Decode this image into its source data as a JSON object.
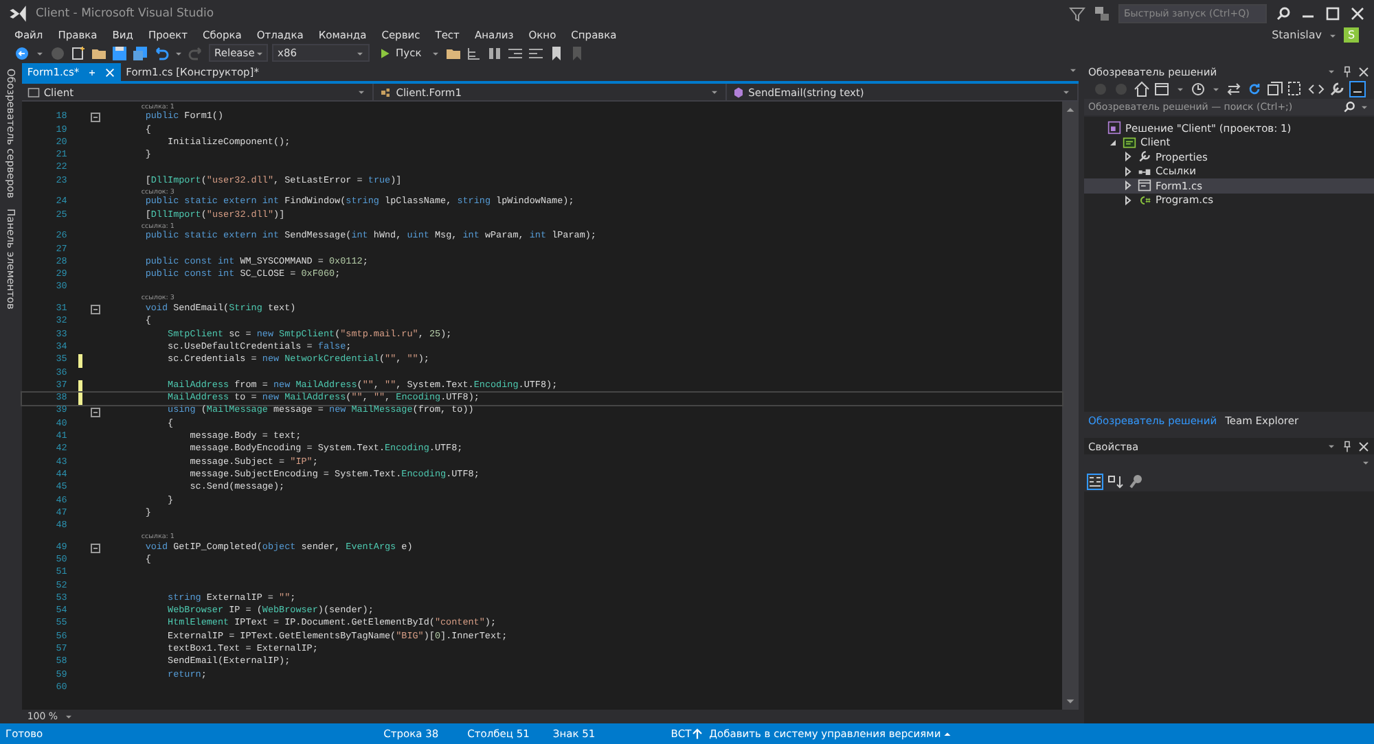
{
  "window": {
    "title": "Client - Microsoft Visual Studio",
    "quick_launch": {
      "placeholder": "Быстрый запуск (Ctrl+Q)"
    },
    "user": {
      "name": "Stanislav",
      "avatar": "S"
    }
  },
  "menu": [
    "Файл",
    "Правка",
    "Вид",
    "Проект",
    "Сборка",
    "Отладка",
    "Команда",
    "Сервис",
    "Тест",
    "Анализ",
    "Окно",
    "Справка"
  ],
  "toolbar": {
    "configuration": "Release",
    "platform": "x86",
    "run": "Пуск"
  },
  "side_tabs": [
    "Обозреватель серверов",
    "Панель элементов"
  ],
  "document_tabs": [
    {
      "label": "Form1.cs*",
      "selected": true
    },
    {
      "label": "Form1.cs [Конструктор]*",
      "selected": false
    }
  ],
  "navigation": {
    "project": "Client",
    "type": "Client.Form1",
    "member": "SendEmail(string text)"
  },
  "code": {
    "lines": [
      {
        "number": "18",
        "lens": "ссылка: 1",
        "foldable": true,
        "modified": false,
        "current": false,
        "tokens": [
          {
            "kind": "kw",
            "text": "public "
          },
          {
            "kind": "p",
            "text": "Form1()"
          }
        ]
      },
      {
        "number": "19",
        "foldable": false,
        "modified": false,
        "current": false,
        "tokens": [
          {
            "kind": "p",
            "text": "{"
          }
        ]
      },
      {
        "number": "20",
        "foldable": false,
        "modified": false,
        "current": false,
        "tokens": [
          {
            "kind": "p",
            "text": "    InitializeComponent();"
          }
        ]
      },
      {
        "number": "21",
        "foldable": false,
        "modified": false,
        "current": false,
        "tokens": [
          {
            "kind": "p",
            "text": "}"
          }
        ]
      },
      {
        "number": "22",
        "foldable": false,
        "modified": false,
        "current": false
      },
      {
        "number": "23",
        "foldable": false,
        "modified": false,
        "current": false,
        "tokens": [
          {
            "kind": "p",
            "text": "["
          },
          {
            "kind": "type",
            "text": "DllImport"
          },
          {
            "kind": "p",
            "text": "("
          },
          {
            "kind": "str",
            "text": "\"user32.dll\""
          },
          {
            "kind": "p",
            "text": ", SetLastError = "
          },
          {
            "kind": "kw",
            "text": "true"
          },
          {
            "kind": "p",
            "text": ")]"
          }
        ]
      },
      {
        "number": "24",
        "lens": "ссылок: 3",
        "foldable": false,
        "modified": false,
        "current": false,
        "tokens": [
          {
            "kind": "kw",
            "text": "public static extern int "
          },
          {
            "kind": "p",
            "text": "FindWindow("
          },
          {
            "kind": "kw",
            "text": "string "
          },
          {
            "kind": "p",
            "text": "lpClassName, "
          },
          {
            "kind": "kw",
            "text": "string "
          },
          {
            "kind": "p",
            "text": "lpWindowName);"
          }
        ]
      },
      {
        "number": "25",
        "foldable": false,
        "modified": false,
        "current": false,
        "tokens": [
          {
            "kind": "p",
            "text": "["
          },
          {
            "kind": "type",
            "text": "DllImport"
          },
          {
            "kind": "p",
            "text": "("
          },
          {
            "kind": "str",
            "text": "\"user32.dll\""
          },
          {
            "kind": "p",
            "text": ")]"
          }
        ]
      },
      {
        "number": "26",
        "lens": "ссылка: 1",
        "foldable": false,
        "modified": false,
        "current": false,
        "tokens": [
          {
            "kind": "kw",
            "text": "public static extern int "
          },
          {
            "kind": "p",
            "text": "SendMessage("
          },
          {
            "kind": "kw",
            "text": "int "
          },
          {
            "kind": "p",
            "text": "hWnd, "
          },
          {
            "kind": "kw",
            "text": "uint "
          },
          {
            "kind": "p",
            "text": "Msg, "
          },
          {
            "kind": "kw",
            "text": "int "
          },
          {
            "kind": "p",
            "text": "wParam, "
          },
          {
            "kind": "kw",
            "text": "int "
          },
          {
            "kind": "p",
            "text": "lParam);"
          }
        ]
      },
      {
        "number": "27",
        "foldable": false,
        "modified": false,
        "current": false
      },
      {
        "number": "28",
        "foldable": false,
        "modified": false,
        "current": false,
        "tokens": [
          {
            "kind": "kw",
            "text": "public const int "
          },
          {
            "kind": "p",
            "text": "WM_SYSCOMMAND = "
          },
          {
            "kind": "num",
            "text": "0x0112"
          },
          {
            "kind": "p",
            "text": ";"
          }
        ]
      },
      {
        "number": "29",
        "foldable": false,
        "modified": false,
        "current": false,
        "tokens": [
          {
            "kind": "kw",
            "text": "public const int "
          },
          {
            "kind": "p",
            "text": "SC_CLOSE = "
          },
          {
            "kind": "num",
            "text": "0xF060"
          },
          {
            "kind": "p",
            "text": ";"
          }
        ]
      },
      {
        "number": "30",
        "foldable": false,
        "modified": false,
        "current": false
      },
      {
        "number": "31",
        "lens": "ссылок: 3",
        "foldable": true,
        "modified": false,
        "current": false,
        "tokens": [
          {
            "kind": "kw",
            "text": "void "
          },
          {
            "kind": "p",
            "text": "SendEmail("
          },
          {
            "kind": "type",
            "text": "String "
          },
          {
            "kind": "p",
            "text": "text)"
          }
        ]
      },
      {
        "number": "32",
        "foldable": false,
        "modified": false,
        "current": false,
        "tokens": [
          {
            "kind": "p",
            "text": "{"
          }
        ]
      },
      {
        "number": "33",
        "foldable": false,
        "modified": false,
        "current": false,
        "tokens": [
          {
            "kind": "type",
            "text": "    SmtpClient "
          },
          {
            "kind": "p",
            "text": "sc = "
          },
          {
            "kind": "kw",
            "text": "new "
          },
          {
            "kind": "type",
            "text": "SmtpClient"
          },
          {
            "kind": "p",
            "text": "("
          },
          {
            "kind": "str",
            "text": "\"smtp.mail.ru\""
          },
          {
            "kind": "p",
            "text": ", "
          },
          {
            "kind": "num",
            "text": "25"
          },
          {
            "kind": "p",
            "text": ");"
          }
        ]
      },
      {
        "number": "34",
        "foldable": false,
        "modified": false,
        "current": false,
        "tokens": [
          {
            "kind": "p",
            "text": "    sc.UseDefaultCredentials = "
          },
          {
            "kind": "kw",
            "text": "false"
          },
          {
            "kind": "p",
            "text": ";"
          }
        ]
      },
      {
        "number": "35",
        "foldable": false,
        "modified": true,
        "current": false,
        "tokens": [
          {
            "kind": "p",
            "text": "    sc.Credentials = "
          },
          {
            "kind": "kw",
            "text": "new "
          },
          {
            "kind": "type",
            "text": "NetworkCredential"
          },
          {
            "kind": "p",
            "text": "("
          },
          {
            "kind": "str",
            "text": "\"\""
          },
          {
            "kind": "p",
            "text": ", "
          },
          {
            "kind": "str",
            "text": "\"\""
          },
          {
            "kind": "p",
            "text": ");"
          }
        ]
      },
      {
        "number": "36",
        "foldable": false,
        "modified": false,
        "current": false
      },
      {
        "number": "37",
        "foldable": false,
        "modified": true,
        "current": false,
        "tokens": [
          {
            "kind": "type",
            "text": "    MailAddress "
          },
          {
            "kind": "p",
            "text": "from = "
          },
          {
            "kind": "kw",
            "text": "new "
          },
          {
            "kind": "type",
            "text": "MailAddress"
          },
          {
            "kind": "p",
            "text": "("
          },
          {
            "kind": "str",
            "text": "\"\""
          },
          {
            "kind": "p",
            "text": ", "
          },
          {
            "kind": "str",
            "text": "\"\""
          },
          {
            "kind": "p",
            "text": ", System.Text."
          },
          {
            "kind": "type",
            "text": "Encoding"
          },
          {
            "kind": "p",
            "text": ".UTF8);"
          }
        ]
      },
      {
        "number": "38",
        "foldable": false,
        "modified": true,
        "current": true,
        "tokens": [
          {
            "kind": "type",
            "text": "    MailAddress "
          },
          {
            "kind": "p",
            "text": "to = "
          },
          {
            "kind": "kw",
            "text": "new "
          },
          {
            "kind": "type",
            "text": "MailAddress"
          },
          {
            "kind": "p",
            "text": "("
          },
          {
            "kind": "str",
            "text": "\"\""
          },
          {
            "kind": "p",
            "text": ", "
          },
          {
            "kind": "str",
            "text": "\"\""
          },
          {
            "kind": "p",
            "text": ", "
          },
          {
            "kind": "type",
            "text": "Encoding"
          },
          {
            "kind": "p",
            "text": ".UTF8);"
          }
        ]
      },
      {
        "number": "39",
        "foldable": true,
        "modified": false,
        "current": false,
        "tokens": [
          {
            "kind": "kw",
            "text": "    using "
          },
          {
            "kind": "p",
            "text": "("
          },
          {
            "kind": "type",
            "text": "MailMessage "
          },
          {
            "kind": "p",
            "text": "message = "
          },
          {
            "kind": "kw",
            "text": "new "
          },
          {
            "kind": "type",
            "text": "MailMessage"
          },
          {
            "kind": "p",
            "text": "(from, to))"
          }
        ]
      },
      {
        "number": "40",
        "foldable": false,
        "modified": false,
        "current": false,
        "tokens": [
          {
            "kind": "p",
            "text": "    {"
          }
        ]
      },
      {
        "number": "41",
        "foldable": false,
        "modified": false,
        "current": false,
        "tokens": [
          {
            "kind": "p",
            "text": "        message.Body = text;"
          }
        ]
      },
      {
        "number": "42",
        "foldable": false,
        "modified": false,
        "current": false,
        "tokens": [
          {
            "kind": "p",
            "text": "        message.BodyEncoding = System.Text."
          },
          {
            "kind": "type",
            "text": "Encoding"
          },
          {
            "kind": "p",
            "text": ".UTF8;"
          }
        ]
      },
      {
        "number": "43",
        "foldable": false,
        "modified": false,
        "current": false,
        "tokens": [
          {
            "kind": "p",
            "text": "        message.Subject = "
          },
          {
            "kind": "str",
            "text": "\"IP\""
          },
          {
            "kind": "p",
            "text": ";"
          }
        ]
      },
      {
        "number": "44",
        "foldable": false,
        "modified": false,
        "current": false,
        "tokens": [
          {
            "kind": "p",
            "text": "        message.SubjectEncoding = System.Text."
          },
          {
            "kind": "type",
            "text": "Encoding"
          },
          {
            "kind": "p",
            "text": ".UTF8;"
          }
        ]
      },
      {
        "number": "45",
        "foldable": false,
        "modified": false,
        "current": false,
        "tokens": [
          {
            "kind": "p",
            "text": "        sc.Send(message);"
          }
        ]
      },
      {
        "number": "46",
        "foldable": false,
        "modified": false,
        "current": false,
        "tokens": [
          {
            "kind": "p",
            "text": "    }"
          }
        ]
      },
      {
        "number": "47",
        "foldable": false,
        "modified": false,
        "current": false,
        "tokens": [
          {
            "kind": "p",
            "text": "}"
          }
        ]
      },
      {
        "number": "48",
        "foldable": false,
        "modified": false,
        "current": false
      },
      {
        "number": "49",
        "lens": "ссылка: 1",
        "foldable": true,
        "modified": false,
        "current": false,
        "tokens": [
          {
            "kind": "kw",
            "text": "void "
          },
          {
            "kind": "p",
            "text": "GetIP_Completed("
          },
          {
            "kind": "kw",
            "text": "object "
          },
          {
            "kind": "p",
            "text": "sender, "
          },
          {
            "kind": "type",
            "text": "EventArgs "
          },
          {
            "kind": "p",
            "text": "e)"
          }
        ]
      },
      {
        "number": "50",
        "foldable": false,
        "modified": false,
        "current": false,
        "tokens": [
          {
            "kind": "p",
            "text": "{"
          }
        ]
      },
      {
        "number": "51",
        "foldable": false,
        "modified": false,
        "current": false
      },
      {
        "number": "52",
        "foldable": false,
        "modified": false,
        "current": false
      },
      {
        "number": "53",
        "foldable": false,
        "modified": false,
        "current": false,
        "tokens": [
          {
            "kind": "kw",
            "text": "    string "
          },
          {
            "kind": "p",
            "text": "ExternalIP = "
          },
          {
            "kind": "str",
            "text": "\"\""
          },
          {
            "kind": "p",
            "text": ";"
          }
        ]
      },
      {
        "number": "54",
        "foldable": false,
        "modified": false,
        "current": false,
        "tokens": [
          {
            "kind": "type",
            "text": "    WebBrowser "
          },
          {
            "kind": "p",
            "text": "IP = ("
          },
          {
            "kind": "type",
            "text": "WebBrowser"
          },
          {
            "kind": "p",
            "text": ")(sender);"
          }
        ]
      },
      {
        "number": "55",
        "foldable": false,
        "modified": false,
        "current": false,
        "tokens": [
          {
            "kind": "type",
            "text": "    HtmlElement "
          },
          {
            "kind": "p",
            "text": "IPText = IP.Document.GetElementById("
          },
          {
            "kind": "str",
            "text": "\"content\""
          },
          {
            "kind": "p",
            "text": ");"
          }
        ]
      },
      {
        "number": "56",
        "foldable": false,
        "modified": false,
        "current": false,
        "tokens": [
          {
            "kind": "p",
            "text": "    ExternalIP = IPText.GetElementsByTagName("
          },
          {
            "kind": "str",
            "text": "\"BIG\""
          },
          {
            "kind": "p",
            "text": ")["
          },
          {
            "kind": "num",
            "text": "0"
          },
          {
            "kind": "p",
            "text": "].InnerText;"
          }
        ]
      },
      {
        "number": "57",
        "foldable": false,
        "modified": false,
        "current": false,
        "tokens": [
          {
            "kind": "p",
            "text": "    textBox1.Text = ExternalIP;"
          }
        ]
      },
      {
        "number": "58",
        "foldable": false,
        "modified": false,
        "current": false,
        "tokens": [
          {
            "kind": "p",
            "text": "    SendEmail(ExternalIP);"
          }
        ]
      },
      {
        "number": "59",
        "foldable": false,
        "modified": false,
        "current": false,
        "tokens": [
          {
            "kind": "kw",
            "text": "    return"
          },
          {
            "kind": "p",
            "text": ";"
          }
        ]
      },
      {
        "number": "60",
        "foldable": false,
        "modified": false,
        "current": false
      }
    ],
    "zoom": "100 %"
  },
  "solution_explorer": {
    "title": "Обозреватель решений",
    "search": {
      "placeholder": "Обозреватель решений — поиск (Ctrl+;)"
    },
    "tree": [
      {
        "label": "Решение \"Client\"  (проектов: 1)",
        "kind": "solution",
        "selected": false,
        "children": [
          {
            "label": "Client",
            "kind": "project",
            "expanded": true,
            "selected": false,
            "children": [
              {
                "label": "Properties",
                "kind": "properties",
                "expanded": false,
                "selected": false
              },
              {
                "label": "Ссылки",
                "kind": "references",
                "expanded": false,
                "selected": false
              },
              {
                "label": "Form1.cs",
                "kind": "form",
                "expanded": false,
                "selected": true
              },
              {
                "label": "Program.cs",
                "kind": "csharp",
                "expanded": false,
                "selected": false
              }
            ]
          }
        ]
      }
    ],
    "tabs": [
      {
        "label": "Обозреватель решений",
        "selected": true
      },
      {
        "label": "Team Explorer",
        "selected": false
      }
    ]
  },
  "properties": {
    "title": "Свойства"
  },
  "status_bar": {
    "message": "Готово",
    "line": "Строка 38",
    "column": "Столбец 51",
    "char": "Знак 51",
    "mode": "ВСТ",
    "source_control": "Добавить в систему управления версиями"
  }
}
